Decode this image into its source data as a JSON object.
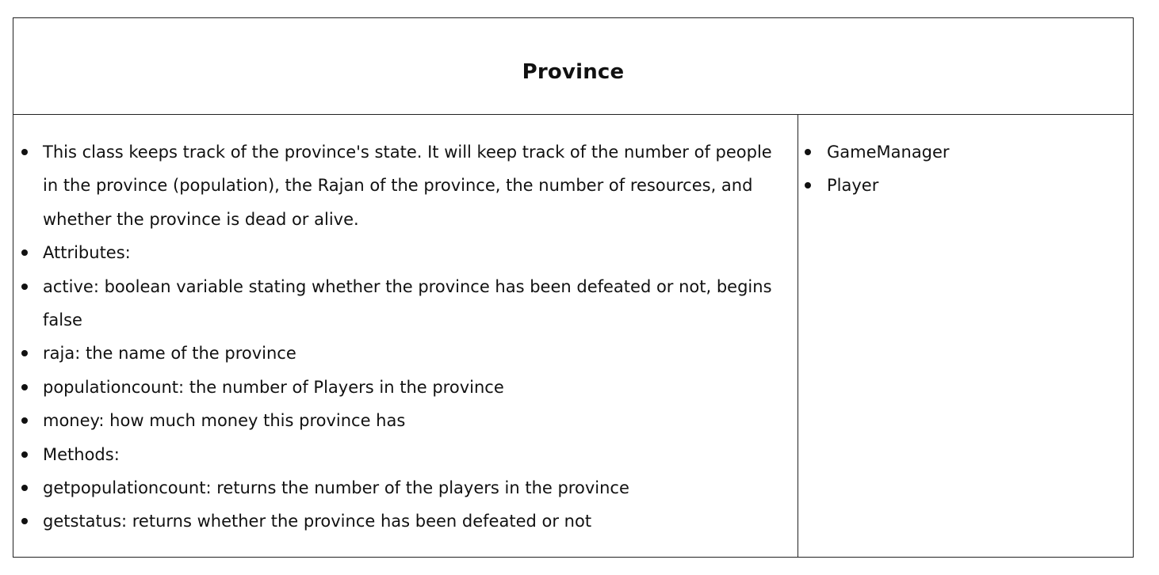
{
  "card": {
    "title": "Province",
    "responsibilities": [
      "This class keeps track of the province's state. It will keep track of the number of people in the province (population), the Rajan of the province, the number of resources, and whether the province is dead or alive.",
      "Attributes:",
      "active: boolean variable stating whether the province has been defeated or not, begins false",
      "raja: the name of the province",
      "populationcount: the number of Players in the province",
      "money: how much money this province has",
      "Methods:",
      "getpopulationcount: returns the number of the players in the province",
      "getstatus: returns whether the province has been defeated or not"
    ],
    "collaborators": [
      "GameManager",
      "Player"
    ]
  }
}
